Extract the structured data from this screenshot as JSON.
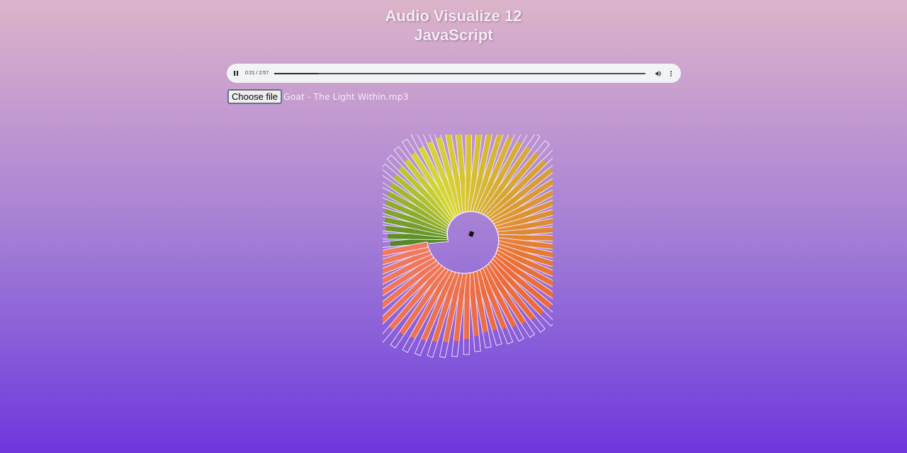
{
  "page": {
    "title_line1": "Audio Visualize 12",
    "title_line2": "JavaScript"
  },
  "player": {
    "current_time": "0:21",
    "duration": "2:57",
    "time_display": "0:21 / 2:57",
    "progress_fraction": 0.119,
    "play_icon": "pause-icon",
    "volume_icon": "volume-icon",
    "menu_icon": "more-vertical-icon"
  },
  "file_input": {
    "button_label": "Choose file",
    "file_name": "Goat - The Light Within.mp3"
  },
  "visualizer": {
    "bar_count": 64,
    "colors": {
      "orange": "#f06a2e",
      "salmon": "#f47a5e",
      "gold": "#d8a62a",
      "yellow": "#d8dc2a",
      "green": "#4f8a1e",
      "outline": "#f5ecff"
    }
  }
}
